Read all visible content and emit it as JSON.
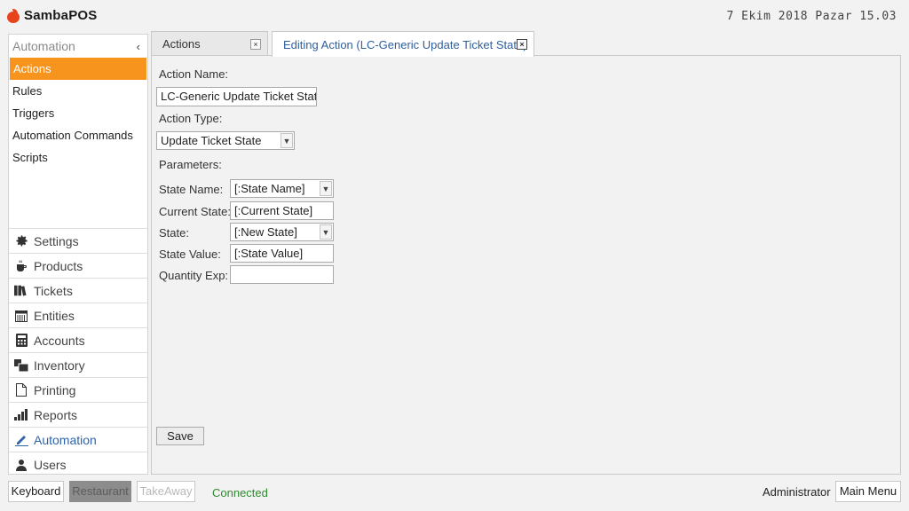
{
  "app": {
    "name": "SambaPOS",
    "clock": "7 Ekim 2018 Pazar 15.03"
  },
  "sidebar": {
    "title": "Automation",
    "collapse_glyph": "‹",
    "items": [
      {
        "label": "Actions",
        "active": true
      },
      {
        "label": "Rules"
      },
      {
        "label": "Triggers"
      },
      {
        "label": "Automation Commands"
      },
      {
        "label": "Scripts"
      }
    ],
    "modules": [
      {
        "label": "Settings",
        "icon": "gear-icon"
      },
      {
        "label": "Products",
        "icon": "coffee-cup-icon"
      },
      {
        "label": "Tickets",
        "icon": "books-icon"
      },
      {
        "label": "Entities",
        "icon": "calendar-icon"
      },
      {
        "label": "Accounts",
        "icon": "calculator-icon"
      },
      {
        "label": "Inventory",
        "icon": "boxes-icon"
      },
      {
        "label": "Printing",
        "icon": "document-icon"
      },
      {
        "label": "Reports",
        "icon": "bar-chart-icon"
      },
      {
        "label": "Automation",
        "icon": "pencil-icon"
      },
      {
        "label": "Users",
        "icon": "user-icon"
      }
    ]
  },
  "tabs": [
    {
      "label": "Actions",
      "close": "×"
    },
    {
      "label": "Editing Action (LC-Generic Update Ticket State)",
      "close": "×"
    }
  ],
  "form": {
    "action_name_label": "Action Name:",
    "action_name_value": "LC-Generic Update Ticket State",
    "action_type_label": "Action Type:",
    "action_type_value": "Update Ticket State",
    "parameters_label": "Parameters:",
    "params": [
      {
        "label": "State Name:",
        "value": "[:State Name]",
        "kind": "combo"
      },
      {
        "label": "Current State:",
        "value": "[:Current State]",
        "kind": "text"
      },
      {
        "label": "State:",
        "value": "[:New State]",
        "kind": "combo"
      },
      {
        "label": "State Value:",
        "value": "[:State Value]",
        "kind": "text"
      },
      {
        "label": "Quantity Exp:",
        "value": "",
        "kind": "text"
      }
    ],
    "save_label": "Save"
  },
  "footer": {
    "keyboard": "Keyboard",
    "restaurant": "Restaurant",
    "takeaway": "TakeAway",
    "status": "Connected",
    "user": "Administrator",
    "main_menu": "Main Menu"
  },
  "colors": {
    "accent": "#f7941d",
    "link": "#2f5f9e",
    "status_ok": "#2e8b2e",
    "brand": "#e8431b"
  }
}
